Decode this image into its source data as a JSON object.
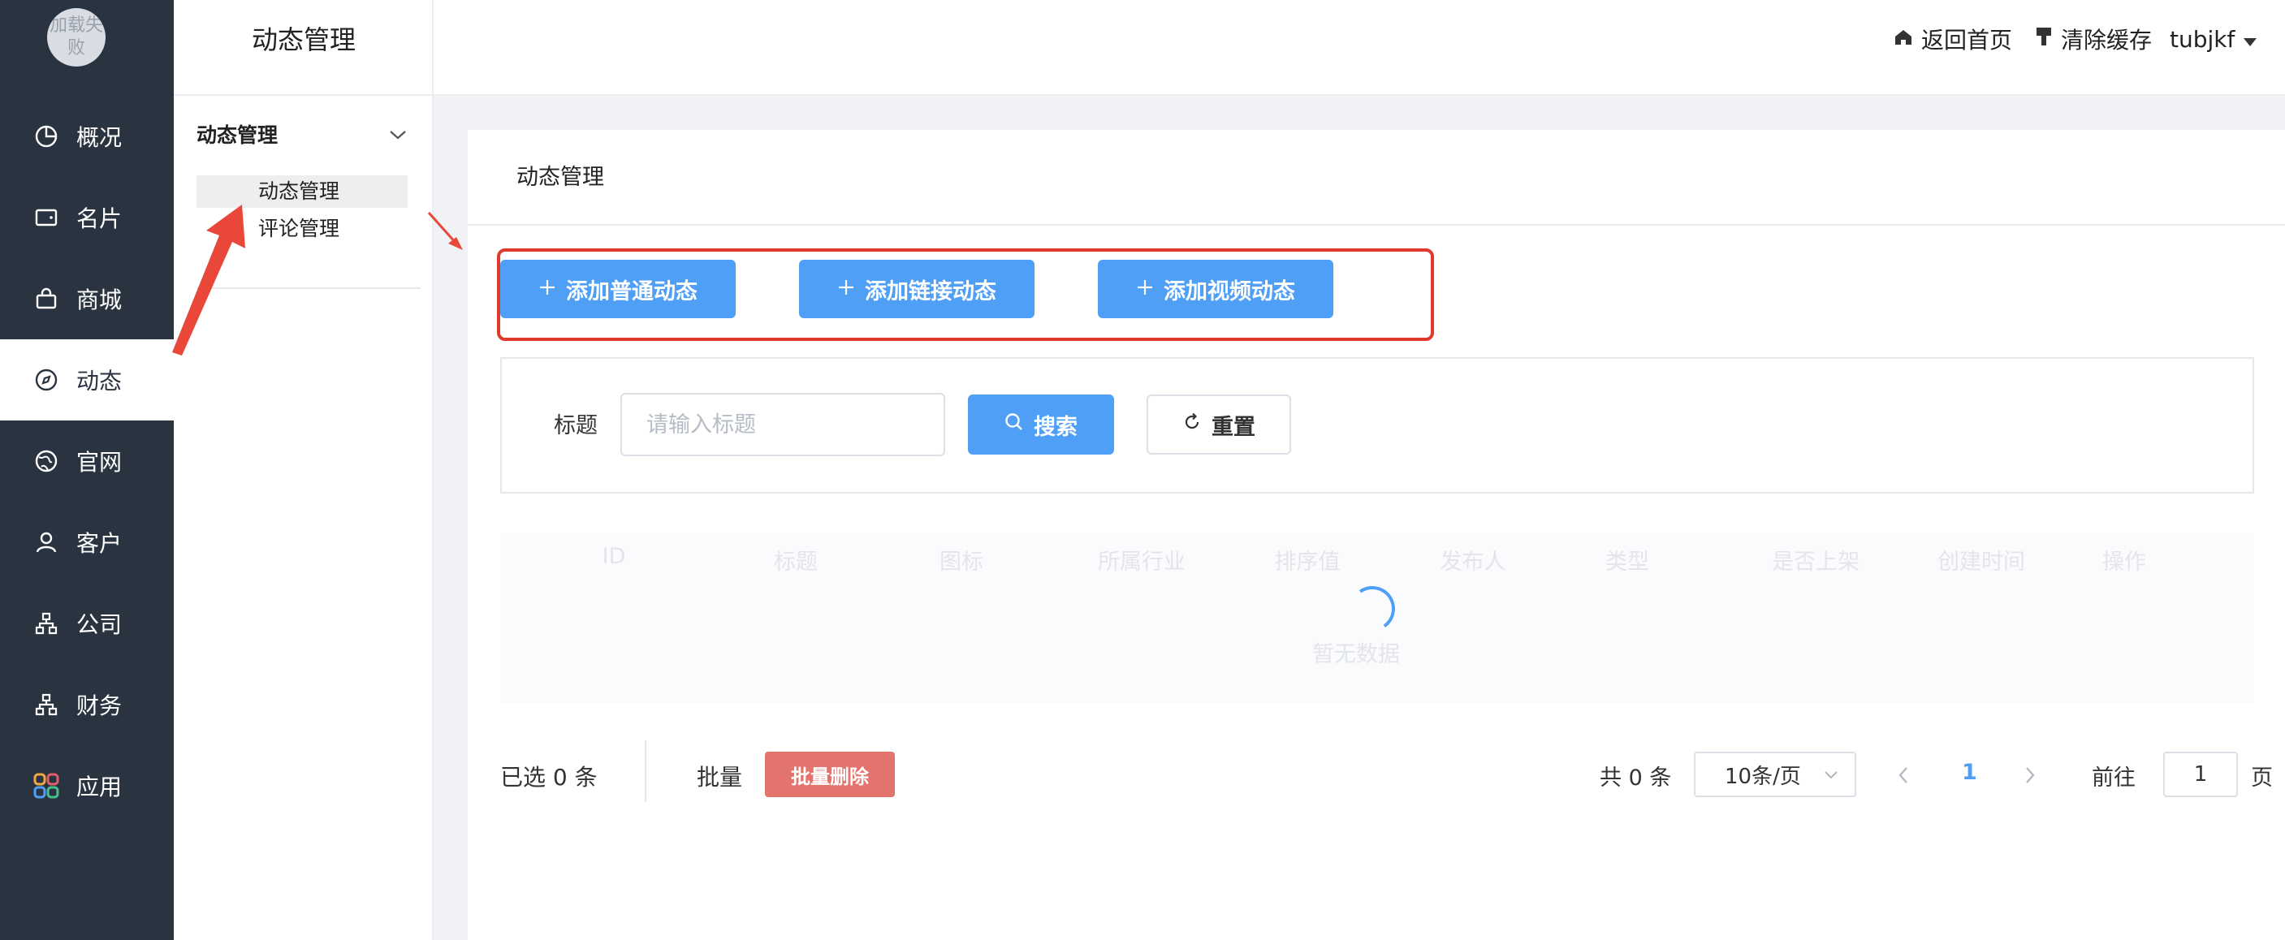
{
  "logo": {
    "text": "加载失败"
  },
  "nav": {
    "items": [
      {
        "label": "概况",
        "icon": "pie-chart-icon"
      },
      {
        "label": "名片",
        "icon": "wallet-icon"
      },
      {
        "label": "商城",
        "icon": "shopping-bag-icon"
      },
      {
        "label": "动态",
        "icon": "compass-icon",
        "active": true
      },
      {
        "label": "官网",
        "icon": "globe-icon"
      },
      {
        "label": "客户",
        "icon": "user-icon"
      },
      {
        "label": "公司",
        "icon": "org-chart-icon"
      },
      {
        "label": "财务",
        "icon": "org-chart-icon"
      },
      {
        "label": "应用",
        "icon": "apps-grid-icon"
      }
    ]
  },
  "submenu": {
    "title": "动态管理",
    "group": "动态管理",
    "items": [
      {
        "label": "动态管理",
        "active": true
      },
      {
        "label": "评论管理"
      }
    ]
  },
  "topbar": {
    "home": "返回首页",
    "clear_cache": "清除缓存",
    "user": "tubjkf"
  },
  "card": {
    "title": "动态管理",
    "actions": {
      "add_normal": "添加普通动态",
      "add_link": "添加链接动态",
      "add_video": "添加视频动态"
    },
    "search": {
      "label": "标题",
      "placeholder": "请输入标题",
      "search_button": "搜索",
      "reset_button": "重置"
    },
    "table": {
      "columns": [
        "ID",
        "标题",
        "图标",
        "所属行业",
        "排序值",
        "发布人",
        "类型",
        "是否上架",
        "创建时间",
        "操作"
      ],
      "empty_text": "暂无数据"
    },
    "footer": {
      "selected": "已选 0 条",
      "batch_label": "批量",
      "batch_delete": "批量删除",
      "total": "共 0 条",
      "page_size": "10条/页",
      "current_page": "1",
      "goto_label": "前往",
      "goto_value": "1",
      "goto_suffix": "页"
    }
  },
  "colors": {
    "nav_bg": "#2a3441",
    "primary": "#4e9ff5",
    "danger": "#e5736d",
    "annotation": "#e03a2e"
  }
}
